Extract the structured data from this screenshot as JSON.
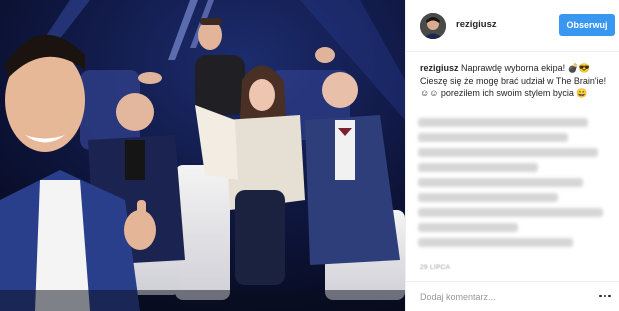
{
  "post": {
    "username": "rezigiusz",
    "follow_label": "Obserwuj",
    "caption_user": "rezigiusz",
    "caption_text": "Naprawdę wyborna ekipa! 💣😎 Cieszę się że mogę brać udział w The Brain'ie! ☺☺ porezilem ich swoim stylem bycia 😀",
    "timestamp": "29 LIPCA",
    "comment_placeholder": "Dodaj komentarz...",
    "icons": {
      "avatar": "user-avatar",
      "more": "more-options-icon"
    }
  },
  "colors": {
    "follow_button": "#3897f0",
    "border": "#efefef",
    "muted_text": "#999999"
  }
}
